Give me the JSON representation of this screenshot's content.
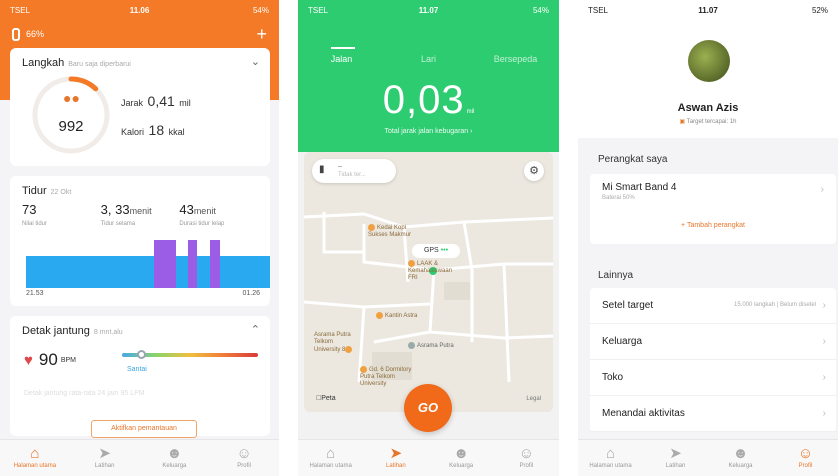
{
  "panel1": {
    "status": {
      "carrier": "TSEL",
      "time": "11.06",
      "battery": "54%"
    },
    "band_battery": "66%",
    "plus": "+",
    "steps_card": {
      "title": "Langkah",
      "subtitle": "Baru saja diperbarui",
      "steps": "992",
      "distance_label": "Jarak",
      "distance_value": "0,41",
      "distance_unit": "mil",
      "calorie_label": "Kalori",
      "calorie_value": "18",
      "calorie_unit": "kkal",
      "progress": 0.12
    },
    "sleep_card": {
      "title": "Tidur",
      "date": "22 Okt",
      "score": "73",
      "score_label": "Nilai tidur",
      "duration_h": "3",
      "duration_m": "33",
      "duration_unit": "menit",
      "duration_label": "Tidur selama",
      "deep_m": "43",
      "deep_unit": "menit",
      "deep_label": "Durasi tidur lelap",
      "start": "21.53",
      "end": "01.26"
    },
    "heart_card": {
      "title": "Detak jantung",
      "subtitle": "8 mnt.alu",
      "bpm": "90",
      "unit": "BPM",
      "state": "Santai",
      "faded": "Detak jantung rata-rata 24 jam 95 LPM",
      "button": "Aktifkan pemantauan"
    },
    "tabs": [
      "Halaman utama",
      "Latihan",
      "Keluarga",
      "Profil"
    ]
  },
  "panel2": {
    "status": {
      "carrier": "TSEL",
      "time": "11.07",
      "battery": "54%"
    },
    "modes": [
      "Jalan",
      "Lari",
      "Bersepeda"
    ],
    "distance": "0,03",
    "distance_unit": "mil",
    "distance_label": "Total jarak jalan kebugaran",
    "device": {
      "name": "--",
      "desc": "Tidak ter..."
    },
    "pois": {
      "p1": "Kedai Kopi\nSukses Makmur",
      "p2": "LAAK &\nKemahasiswaan\nFRI",
      "p3": "Kantin Astra",
      "p4": "Asrama Putra\nTelkom\nUniversity 8",
      "p5": "Asrama Putra",
      "p6": "Gd. 6 Dormitory\nPutra Telkom\nUniversity"
    },
    "gps": "GPS",
    "map_brand": "Peta",
    "legal": "Legal",
    "go": "GO",
    "tabs": [
      "Halaman utama",
      "Latihan",
      "Keluarga",
      "Profil"
    ]
  },
  "panel3": {
    "status": {
      "carrier": "TSEL",
      "time": "11.07",
      "battery": "52%"
    },
    "name": "Aswan Azis",
    "target": "Target tercapai: 1h",
    "devices_label": "Perangkat saya",
    "device_name": "Mi Smart Band 4",
    "device_battery": "Baterai 50%",
    "add_device": "+ Tambah perangkat",
    "other_label": "Lainnya",
    "items": [
      {
        "label": "Setel target",
        "value": "15.000 langkah | Belum disetel"
      },
      {
        "label": "Keluarga",
        "value": ""
      },
      {
        "label": "Toko",
        "value": ""
      },
      {
        "label": "Menandai aktivitas",
        "value": ""
      }
    ],
    "tabs": [
      "Halaman utama",
      "Latihan",
      "Keluarga",
      "Profil"
    ]
  }
}
